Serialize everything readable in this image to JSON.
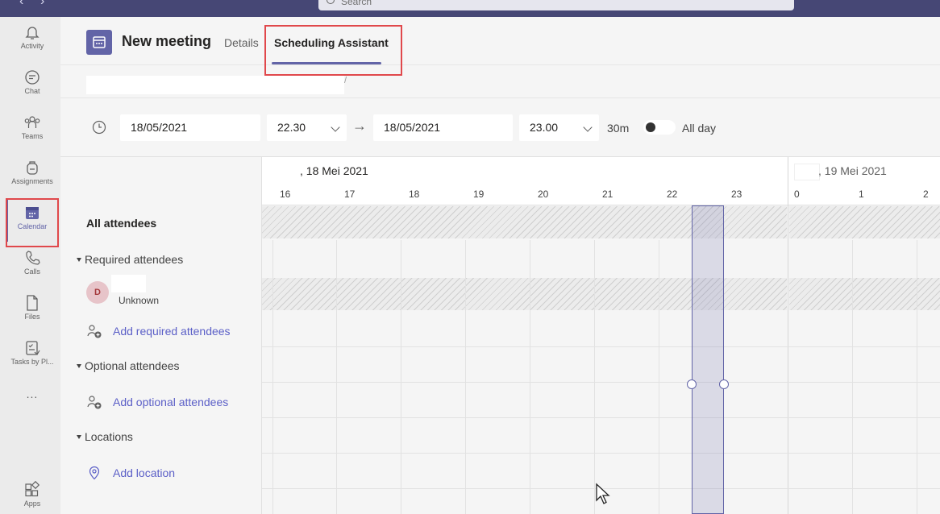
{
  "search": {
    "placeholder": "Search"
  },
  "rail": {
    "items": [
      {
        "label": "Activity",
        "icon": "bell-icon"
      },
      {
        "label": "Chat",
        "icon": "chat-icon"
      },
      {
        "label": "Teams",
        "icon": "teams-icon"
      },
      {
        "label": "Assignments",
        "icon": "backpack-icon"
      },
      {
        "label": "Calendar",
        "icon": "calendar-icon",
        "active": true
      },
      {
        "label": "Calls",
        "icon": "phone-icon"
      },
      {
        "label": "Files",
        "icon": "file-icon"
      },
      {
        "label": "Tasks by Pl...",
        "icon": "tasks-icon"
      },
      {
        "label": "...",
        "icon": "more-icon"
      },
      {
        "label": "Apps",
        "icon": "apps-icon"
      }
    ]
  },
  "header": {
    "title": "New meeting",
    "tabs": [
      {
        "label": "Details",
        "active": false
      },
      {
        "label": "Scheduling Assistant",
        "active": true
      }
    ]
  },
  "time": {
    "start_date": "18/05/2021",
    "start_time": "22.30",
    "end_date": "18/05/2021",
    "end_time": "23.00",
    "duration": "30m",
    "arrow": "→",
    "all_day_label": "All day",
    "all_day_on": false
  },
  "attendees": {
    "all_label": "All attendees",
    "required_header": "Required attendees",
    "required": [
      {
        "initial": "D",
        "status": "Unknown"
      }
    ],
    "add_required": "Add required attendees",
    "optional_header": "Optional attendees",
    "add_optional": "Add optional attendees",
    "locations_header": "Locations",
    "add_location": "Add location"
  },
  "schedule": {
    "day1": ", 18 Mei 2021",
    "day2": ", 19 Mei 2021",
    "hours_day1": [
      "16",
      "17",
      "18",
      "19",
      "20",
      "21",
      "22",
      "23"
    ],
    "hours_day2": [
      "0",
      "1",
      "2"
    ],
    "selection_start": "22.30",
    "selection_end": "23.00"
  },
  "colors": {
    "accent": "#6264a7",
    "topbar": "#464775",
    "highlight": "#e0484b",
    "link": "#5b5fc7"
  }
}
